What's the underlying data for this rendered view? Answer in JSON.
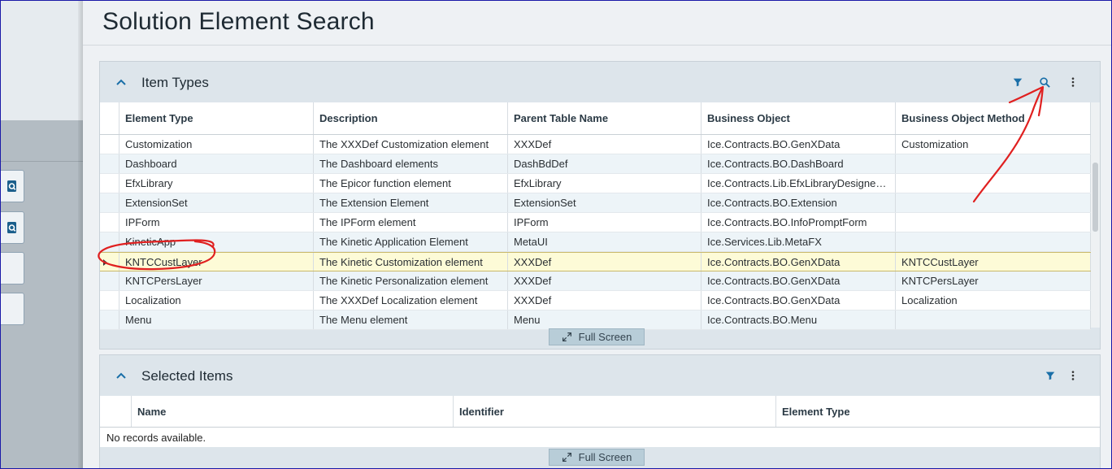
{
  "page": {
    "title": "Solution Element Search"
  },
  "colors": {
    "accent": "#1a6fa8",
    "annotation": "#e02020",
    "selected_row": "#fdfbd7"
  },
  "item_types": {
    "title": "Item Types",
    "columns": [
      "Element Type",
      "Description",
      "Parent Table Name",
      "Business Object",
      "Business Object Method"
    ],
    "rows": [
      [
        "Customization",
        "The XXXDef Customization element",
        "XXXDef",
        "Ice.Contracts.BO.GenXData",
        "Customization"
      ],
      [
        "Dashboard",
        "The Dashboard elements",
        "DashBdDef",
        "Ice.Contracts.BO.DashBoard",
        ""
      ],
      [
        "EfxLibrary",
        "The Epicor function element",
        "EfxLibrary",
        "Ice.Contracts.Lib.EfxLibraryDesigne…",
        ""
      ],
      [
        "ExtensionSet",
        "The Extension Element",
        "ExtensionSet",
        "Ice.Contracts.BO.Extension",
        ""
      ],
      [
        "IPForm",
        "The IPForm element",
        "IPForm",
        "Ice.Contracts.BO.InfoPromptForm",
        ""
      ],
      [
        "KineticApp",
        "The Kinetic Application Element",
        "MetaUI",
        "Ice.Services.Lib.MetaFX",
        ""
      ],
      [
        "KNTCCustLayer",
        "The Kinetic Customization element",
        "XXXDef",
        "Ice.Contracts.BO.GenXData",
        "KNTCCustLayer"
      ],
      [
        "KNTCPersLayer",
        "The Kinetic Personalization element",
        "XXXDef",
        "Ice.Contracts.BO.GenXData",
        "KNTCPersLayer"
      ],
      [
        "Localization",
        "The XXXDef Localization element",
        "XXXDef",
        "Ice.Contracts.BO.GenXData",
        "Localization"
      ],
      [
        "Menu",
        "The Menu element",
        "Menu",
        "Ice.Contracts.BO.Menu",
        ""
      ]
    ],
    "selected_row": 6,
    "full_screen_label": "Full Screen",
    "icons": [
      "filter-icon",
      "search-icon",
      "more-vertical-icon"
    ]
  },
  "selected_items": {
    "title": "Selected Items",
    "columns": [
      "Name",
      "Identifier",
      "Element Type"
    ],
    "empty_text": "No records available.",
    "full_screen_label": "Full Screen",
    "icons": [
      "filter-icon",
      "more-vertical-icon"
    ]
  },
  "left_pane": {
    "icons": [
      "search-doc-icon",
      "search-doc-icon"
    ]
  }
}
